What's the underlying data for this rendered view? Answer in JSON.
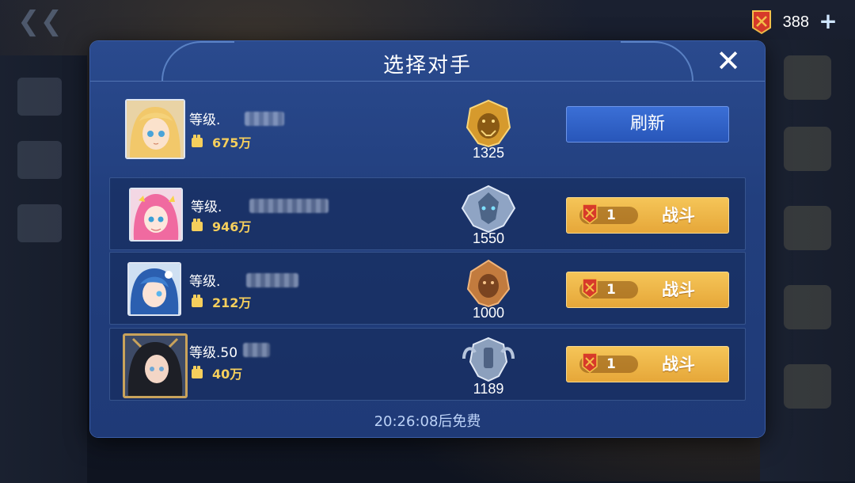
{
  "dialog": {
    "title": "选择对手",
    "timer": "20:26:08后免费"
  },
  "currency": {
    "amount": "388",
    "plus_label": "+"
  },
  "level_prefix": "等级.",
  "refresh_label": "刷新",
  "fight_label": "战斗",
  "opponents": [
    {
      "level": "",
      "power": "675万",
      "rank_score": "1325",
      "rank_tier": "gold-lion",
      "action": "refresh"
    },
    {
      "level": "",
      "power": "946万",
      "rank_score": "1550",
      "rank_tier": "silver-wolf",
      "action": "fight",
      "cost": "1"
    },
    {
      "level": "",
      "power": "212万",
      "rank_score": "1000",
      "rank_tier": "bronze-lion",
      "action": "fight",
      "cost": "1"
    },
    {
      "level": "50",
      "power": "40万",
      "rank_score": "1189",
      "rank_tier": "silver-helm",
      "action": "fight",
      "cost": "1"
    }
  ],
  "colors": {
    "dialog_bg": "#223f7e",
    "power_gold": "#f6cf5c",
    "fight_button": "#e6a739",
    "refresh_button": "#2856b9",
    "ticket_red": "#d73a2a"
  }
}
